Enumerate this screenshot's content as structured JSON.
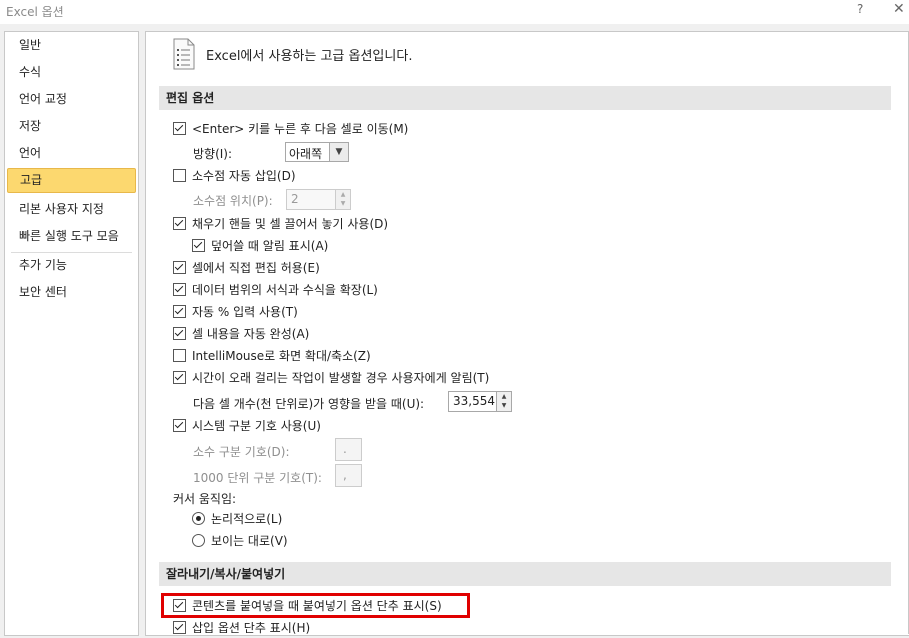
{
  "window": {
    "title": "Excel 옵션",
    "help": "?",
    "close": "✕"
  },
  "sidebar": {
    "items": [
      {
        "label": "일반"
      },
      {
        "label": "수식"
      },
      {
        "label": "언어 교정"
      },
      {
        "label": "저장"
      },
      {
        "label": "언어"
      },
      {
        "label": "고급",
        "selected": true
      },
      {
        "label": "리본 사용자 지정"
      },
      {
        "label": "빠른 실행 도구 모음"
      },
      {
        "label": "추가 기능"
      },
      {
        "label": "보안 센터"
      }
    ]
  },
  "header": {
    "icon": "document-options-icon",
    "text": "Excel에서 사용하는 고급 옵션입니다."
  },
  "editing": {
    "title": "편집 옵션",
    "enter_move": {
      "label": "<Enter> 키를 누른 후 다음 셀로 이동(M)",
      "checked": true
    },
    "direction_label": "방향(I):",
    "direction_value": "아래쪽",
    "auto_decimal": {
      "label": "소수점 자동 삽입(D)",
      "checked": false
    },
    "decimal_places_label": "소수점 위치(P):",
    "decimal_places_value": "2",
    "fill_handle": {
      "label": "채우기 핸들 및 셀 끌어서 놓기 사용(D)",
      "checked": true
    },
    "overwrite_alert": {
      "label": "덮어쓸 때 알림 표시(A)",
      "checked": true
    },
    "edit_in_cell": {
      "label": "셀에서 직접 편집 허용(E)",
      "checked": true
    },
    "extend_formats": {
      "label": "데이터 범위의 서식과 수식을 확장(L)",
      "checked": true
    },
    "auto_percent": {
      "label": "자동 % 입력 사용(T)",
      "checked": true
    },
    "autocomplete": {
      "label": "셀 내용을 자동 완성(A)",
      "checked": true
    },
    "intellimouse": {
      "label": "IntelliMouse로 화면 확대/축소(Z)",
      "checked": false
    },
    "long_op_alert": {
      "label": "시간이 오래 걸리는 작업이 발생할 경우 사용자에게 알림(T)",
      "checked": true
    },
    "cells_affected_label": "다음 셀 개수(천 단위로)가 영향을 받을 때(U):",
    "cells_affected_value": "33,554",
    "system_separators": {
      "label": "시스템 구분 기호 사용(U)",
      "checked": true
    },
    "decimal_sep_label": "소수 구분 기호(D):",
    "decimal_sep_value": ".",
    "thousands_sep_label": "1000 단위 구분 기호(T):",
    "thousands_sep_value": ",",
    "cursor_label": "커서 움직임:",
    "cursor_logical": {
      "label": "논리적으로(L)",
      "selected": true
    },
    "cursor_visual": {
      "label": "보이는 대로(V)",
      "selected": false
    }
  },
  "cutcopy": {
    "title": "잘라내기/복사/붙여넣기",
    "paste_options": {
      "label": "콘텐츠를 붙여넣을 때 붙여넣기 옵션 단추 표시(S)",
      "checked": true,
      "highlighted": true,
      "highlight_color": "#e00000"
    },
    "insert_options": {
      "label": "삽입 옵션 단추 표시(H)",
      "checked": true
    }
  },
  "colors": {
    "selected_nav": "#fcd86f",
    "section_band": "#e6e6e6"
  }
}
